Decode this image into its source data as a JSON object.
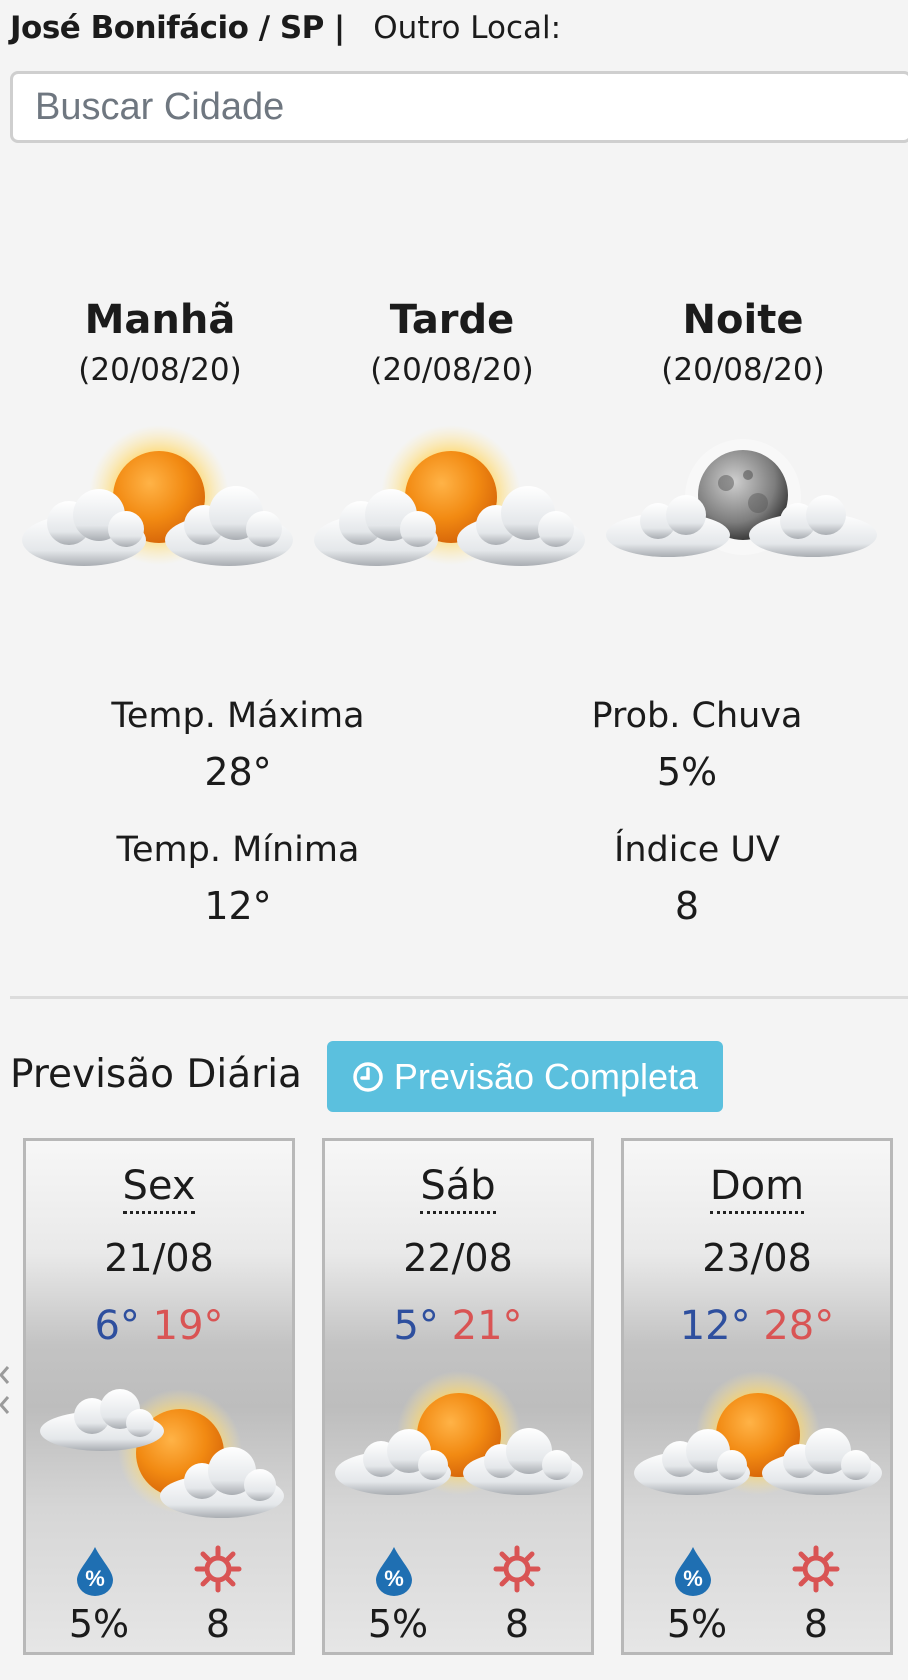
{
  "header": {
    "city": "José Bonifácio / SP",
    "separator": "|",
    "other_location_label": "Outro Local:"
  },
  "search": {
    "placeholder": "Buscar Cidade",
    "value": ""
  },
  "periods": [
    {
      "name": "Manhã",
      "date": "(20/08/20)",
      "icon": "sun-behind-clouds-icon"
    },
    {
      "name": "Tarde",
      "date": "(20/08/20)",
      "icon": "sun-behind-clouds-icon"
    },
    {
      "name": "Noite",
      "date": "(20/08/20)",
      "icon": "moon-behind-clouds-icon"
    }
  ],
  "stats": {
    "max_temp": {
      "label": "Temp. Máxima",
      "value": "28°"
    },
    "min_temp": {
      "label": "Temp. Mínima",
      "value": "12°"
    },
    "rain_prob": {
      "label": "Prob. Chuva",
      "value": "5%"
    },
    "uv_index": {
      "label": "Índice UV",
      "value": "8"
    }
  },
  "daily": {
    "title": "Previsão Diária",
    "full_forecast_button": "Previsão Completa",
    "days": [
      {
        "day": "Sex",
        "date": "21/08",
        "min": "6°",
        "max": "19°",
        "rain": "5%",
        "uv": "8",
        "icon": "partly-cloudy-icon"
      },
      {
        "day": "Sáb",
        "date": "22/08",
        "min": "5°",
        "max": "21°",
        "rain": "5%",
        "uv": "8",
        "icon": "sun-behind-clouds-icon"
      },
      {
        "day": "Dom",
        "date": "23/08",
        "min": "12°",
        "max": "28°",
        "rain": "5%",
        "uv": "8",
        "icon": "sun-behind-clouds-icon"
      }
    ]
  },
  "colors": {
    "background": "#f4f4f4",
    "button": "#5bc0de",
    "min_temp": "#2e4f9e",
    "max_temp": "#d95454",
    "rain_drop": "#1f6fb2",
    "uv_sun": "#d95454"
  }
}
